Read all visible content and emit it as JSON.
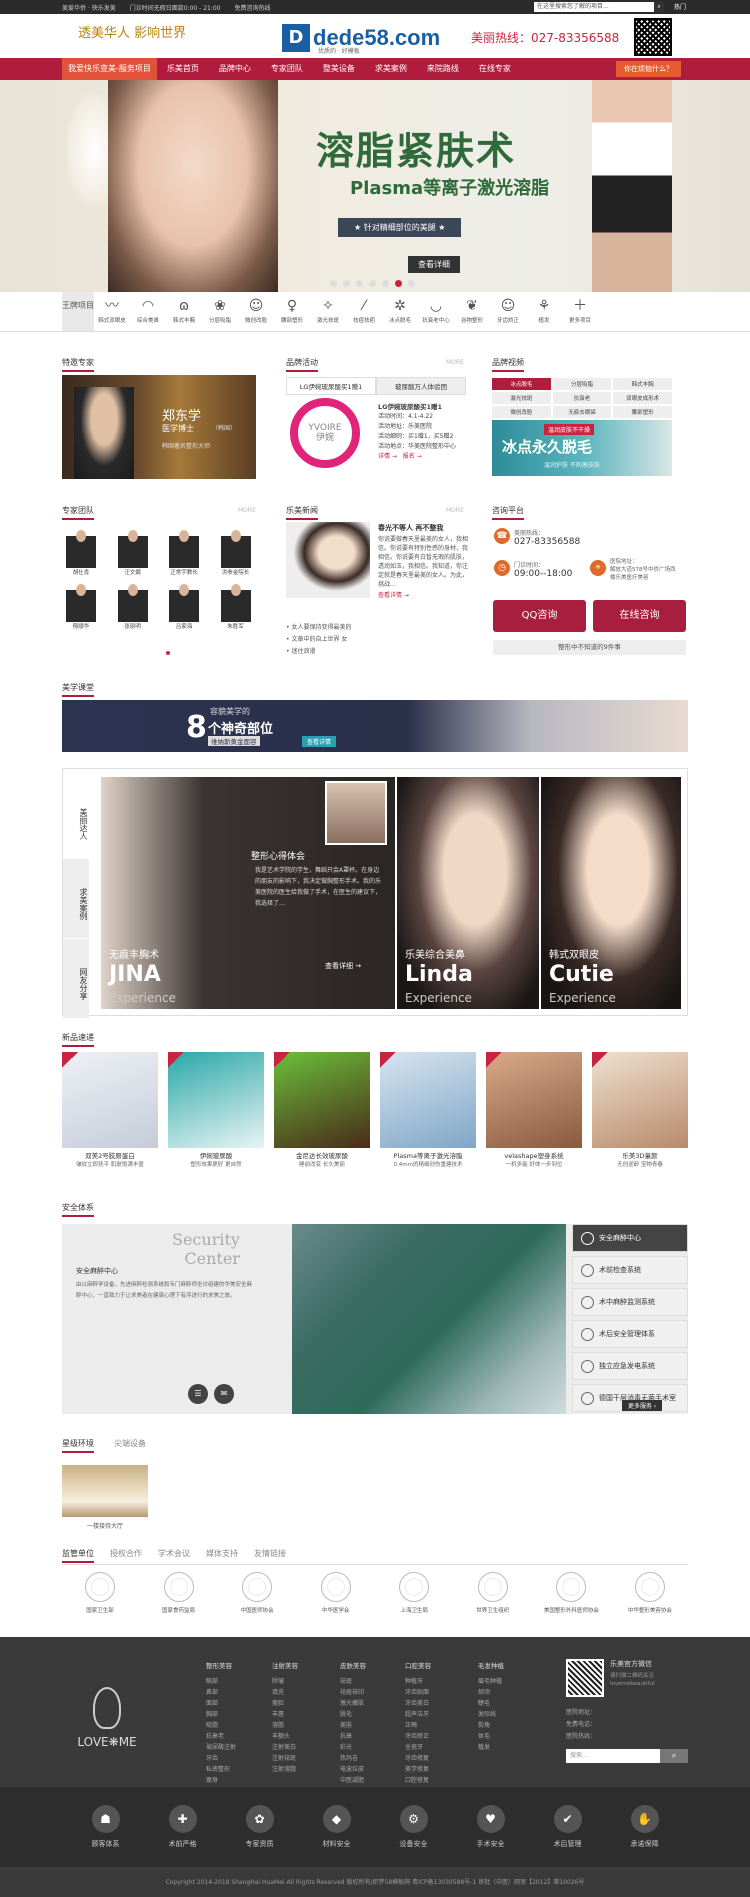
{
  "topbar": {
    "links": [
      "美爱华侨 · 快乐发美",
      "门诊时间无假日面款0:00 - 21:00",
      "免费咨询热线"
    ],
    "search_placeholder": "在这里搜索您了解的项目...",
    "door": "热门"
  },
  "header": {
    "brand_left": "透美华人 影响世界",
    "brand_left_sub": "",
    "logo_letter": "D",
    "logo_text": "dede58.com",
    "logo_tag": "优质的 · 好模板",
    "hotline": "美丽热线：027-83356588"
  },
  "nav": {
    "items": [
      "我爱快乐变美-服务项目",
      "乐美首页",
      "品牌中心",
      "专家团队",
      "整美设备",
      "求美案例",
      "来院路线",
      "在线专家"
    ],
    "ask": "你在烦恼什么？"
  },
  "banner": {
    "title": "溶脂紧肤术",
    "subtitle": "Plasma等离子激光溶脂",
    "tagline": "★ 针对精细部位的美腿 ★",
    "button": "查看详细"
  },
  "cats": {
    "king": "王牌项目",
    "items": [
      "韩式双眼皮",
      "综合美鼻",
      "韩式丰胸",
      "分层吸脂",
      "微创改脸",
      "腰部塑形",
      "激光祛斑",
      "祛痘祛疤",
      "冰点脱毛",
      "抗衰老中心",
      "谷物整形",
      "牙齿矫正",
      "植发",
      "更多项目"
    ],
    "icons": [
      "〰",
      "◠",
      "ɷ",
      "❀",
      "☺",
      "♀",
      "✧",
      "⁄",
      "✲",
      "◡",
      "❦",
      "☺",
      "⚘",
      "＋"
    ]
  },
  "s1": {
    "expert_title": "特邀专家",
    "expert_name": "郑东学",
    "expert_role": "医学博士",
    "expert_role2": "（韩国）",
    "expert_desc": "韩国著名整形大师",
    "brand_title": "品牌活动",
    "tabs": [
      "LG伊婉玻尿酸买1赠1",
      "玻尿酸万人体验团"
    ],
    "logo": "YVOIRE",
    "logo_cn": "伊婉",
    "act_title": "LG伊婉玻尿酸买1赠1",
    "act_lines": [
      "活动时间：4.1-4.22",
      "活动地址：乐美医院",
      "活动细则：买1赠1，买5赠2",
      "活动地点：华美医院整形中心"
    ],
    "act_links": [
      "详情 →",
      "报名 →"
    ],
    "video_title": "品牌视频",
    "video_tabs": [
      "冰点脱毛",
      "分层吸脂",
      "韩式丰胸",
      "激光祛斑",
      "抗衰老",
      "双眼皮成形术",
      "微创改脸",
      "无痕去眼袋",
      "腰部塑形"
    ],
    "video_t1": "冰点永久脱毛",
    "video_t2": "温润护肤 不刺激皮肤",
    "video_top": "温润皮肤不干燥"
  },
  "s2": {
    "team_title": "专家团队",
    "team": [
      "胡仕肯",
      "汪文娟",
      "正常宇教长",
      "洪参金院长",
      "郁顺华",
      "张丽明",
      "吕家海",
      "朱胜军"
    ],
    "news_title": "乐美新闻",
    "news_head": "春光不等人 再不整我",
    "news_body": "你说要做春天里最美的女人，我相信。你说要有特别性感的身材，我相信。你说要有白皙无瑕的肌肤，透润如玉，我相信。我知道，你注定就是春天里最美的女人。为此，挑战…",
    "news_more": "查看详情 →",
    "news_list": [
      "女人要保持变得最美的",
      "文章中的自上世界 女",
      "迷住浪漫"
    ],
    "consult_title": "咨询平台",
    "tel_label": "美丽热线：",
    "tel": "027-83356588",
    "hours_label": "门诊时间：",
    "hours": "09:00--18:00",
    "addr_label": "医院地址：",
    "addr": "解放大道578号中侨广场西楼乐美医疗美容",
    "qq": "QQ咨询",
    "online": "在线咨询",
    "consult_bar": "整形中不知道的9件事"
  },
  "promo": {
    "line1": "容貌美学的",
    "num": "8",
    "line2": "个神奇部位",
    "line3": "维纳斯黄金面容",
    "btn": "查看详情"
  },
  "show": {
    "tabs": [
      "美丽达人",
      "求美案例",
      "网友分享"
    ],
    "p1_sub": "无痕丰胸术",
    "p1": "JINA",
    "p1_cn": "整形心得体会",
    "p1_text": "我是艺术学院的学生，舞蹈只会A罩杯。在身边的朋友的影响下，我决定做胸整形手术。我的乐美医院的医生给我做了手术，在医生的建议下，我选择了…",
    "p1_more": "查看详细 →",
    "p2_sub": "乐美综合美鼻",
    "p2": "Linda",
    "p3_sub": "韩式双眼皮",
    "p3": "Cutie",
    "xp": "Experience"
  },
  "products": {
    "title": "新品速递",
    "items": [
      {
        "n1": "双美2号胶原蛋白",
        "n2": "皱纹立即抚平 肌肤饱满丰盈"
      },
      {
        "n1": "伊婉玻尿酸",
        "n2": "塑形效果更好 更自然"
      },
      {
        "n1": "金尼达长效玻尿酸",
        "n2": "睡前改变 长久美丽"
      },
      {
        "n1": "Plasma等离子激光溶脂",
        "n2": "0.4mm的精细创伤重建技术"
      },
      {
        "n1": "velashape塑身系统",
        "n2": "一机多能 好体一步到位"
      },
      {
        "n1": "乐美3D童颜",
        "n2": "无创逆龄 宝物青春"
      }
    ]
  },
  "safety": {
    "title": "安全体系",
    "en1": "Security",
    "en2": "Center",
    "cn": "安全麻醉中心",
    "text": "由以麻醉学设备，先进麻醉检测系统和专门麻醉师坐诊组建的华美安全麻醉中心，一直致力于让求美者在健康心理下有序进行的求美之旅。",
    "items": [
      "安全麻醉中心",
      "术前检查系统",
      "术中麻醉监测系统",
      "术后安全管理体系",
      "独立应急发电系统",
      "德国干层消毒无菌手术室"
    ],
    "more": "更多服务 ›"
  },
  "env": {
    "tabs": [
      "星级环境",
      "尖端设备"
    ],
    "cap": "一楼接待大厅"
  },
  "partners": {
    "tabs": [
      "监管单位",
      "授权合作",
      "学术会议",
      "媒体支持",
      "友情链接"
    ],
    "items": [
      "国家卫生部",
      "国家食药监局",
      "中国医师协会",
      "中华医学会",
      "上海卫生局",
      "世界卫生组织",
      "美国整形外科医师协会",
      "中华整形美容协会"
    ]
  },
  "footer": {
    "logo": "LOVE❋ME",
    "cols": [
      {
        "h": "整形美容",
        "items": [
          "眼部",
          "鼻部",
          "面部",
          "胸部",
          "吸脂",
          "抗衰老",
          "玻尿酸注射",
          "牙齿",
          "私密整形",
          "瘦身"
        ]
      },
      {
        "h": "注射美容",
        "items": [
          "除皱",
          "填充",
          "瘦脸",
          "丰唇",
          "溶脂",
          "丰额头",
          "注射美白",
          "注射祛斑",
          "注射溶脂"
        ]
      },
      {
        "h": "皮肤美容",
        "items": [
          "祛斑",
          "祛痘祛印",
          "激光嫩肤",
          "脱毛",
          "美肤",
          "抗衰",
          "彩光",
          "热玛吉",
          "电波拉皮",
          "中医减肥"
        ]
      },
      {
        "h": "口腔美容",
        "items": [
          "种植牙",
          "牙齿贴面",
          "牙齿美白",
          "超声洁牙",
          "正畸",
          "牙齿矫正",
          "全瓷牙",
          "牙齿修复",
          "美学修复",
          "口腔修复"
        ]
      },
      {
        "h": "毛发种植",
        "items": [
          "眉毛种植",
          "胡须",
          "睫毛",
          "发际线",
          "鬓角",
          "体毛",
          "植发"
        ]
      }
    ],
    "wx_title": "乐美官方微信",
    "wx_t1": "请扫描二维码关注",
    "wx_t2": "lovemebeautiful",
    "addr1": "医院地址：",
    "addr2": "免费电话：",
    "addr3": "医院热线：",
    "search_placeholder": "搜索...",
    "icons": [
      {
        "label": "顾客体系",
        "g": "☗"
      },
      {
        "label": "术前严格",
        "g": "✚"
      },
      {
        "label": "专家资质",
        "g": "✿"
      },
      {
        "label": "材料安全",
        "g": "◆"
      },
      {
        "label": "设备安全",
        "g": "⚙"
      },
      {
        "label": "手术安全",
        "g": "♥"
      },
      {
        "label": "术后管理",
        "g": "✔"
      },
      {
        "label": "承诺保障",
        "g": "✋"
      }
    ],
    "copy": "Copyright 2014-2018 ShangHai HuaMei All Rights Reserved    版权所有/织梦58模板网    粤ICP备13030588号-1    审批（中医）网审【2012】第10026号"
  }
}
